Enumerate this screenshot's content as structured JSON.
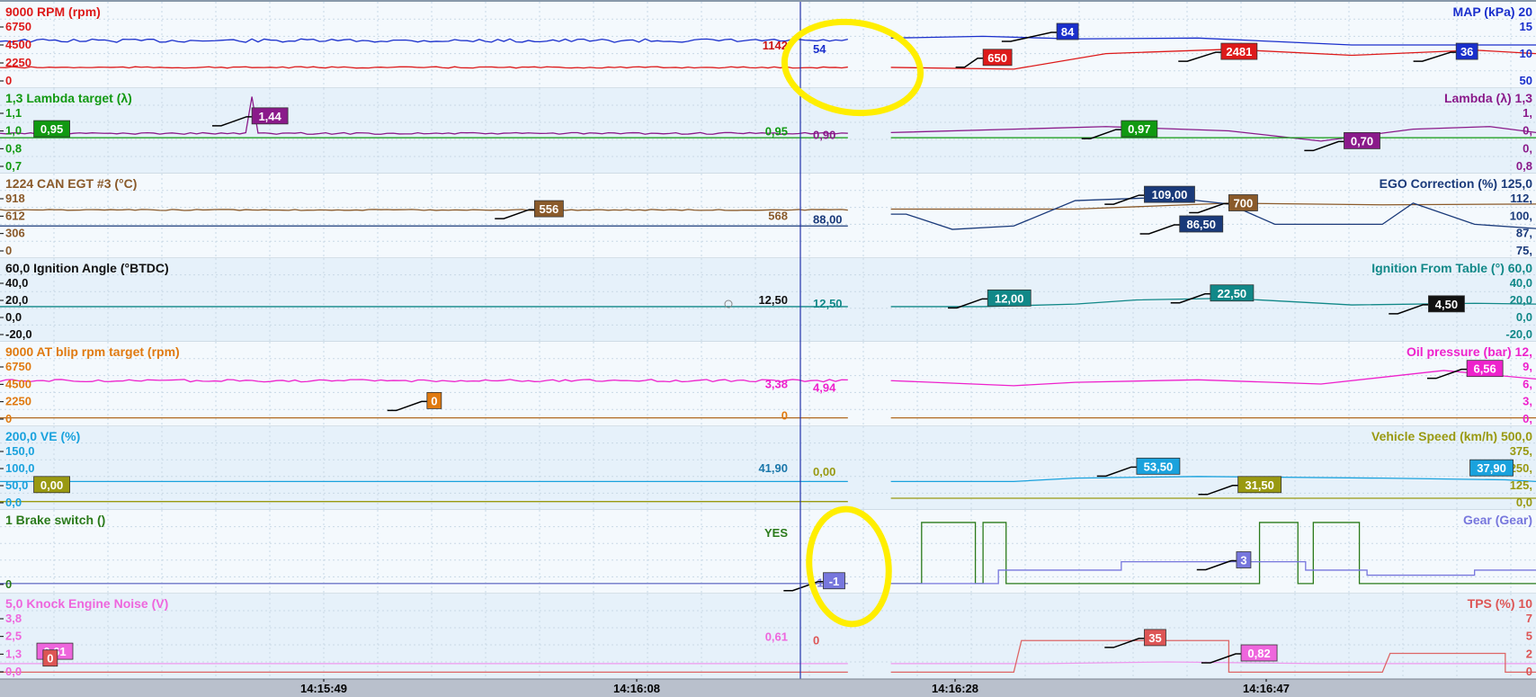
{
  "colors": {
    "bg_a": "#f4f9fd",
    "bg_b": "#e6f1fa",
    "grid": "#c9d9e6",
    "separator": "#b8c6d2",
    "cursor": "#2233aa",
    "timebar_bg": "#b9c0cc",
    "timebar_text": "#000000",
    "highlight": "#ffee00"
  },
  "time_axis": {
    "ticks": [
      "14:15:49",
      "14:16:08",
      "14:16:28",
      "14:16:47"
    ]
  },
  "cursor": {
    "position_fraction": 0.521
  },
  "lanes": [
    {
      "id": "rpm-map",
      "left": {
        "title": "9000 RPM (rpm)",
        "color": "#dd1a1a",
        "ticks": [
          "6750",
          "4500",
          "2250",
          "0"
        ]
      },
      "right": {
        "title": "MAP (kPa) 20",
        "color": "#1a2fcc",
        "ticks": [
          "15",
          "10",
          "50"
        ]
      },
      "cursor_left": {
        "text": "1142",
        "color": "#cc1111"
      },
      "cursor_right": {
        "text": "54",
        "color": "#1a2fcc"
      },
      "tags": [
        {
          "text": "84",
          "bg": "#1a2fcc",
          "fg": "#ffffff",
          "fx": 0.688,
          "fy": 0.25,
          "lead": 0.03
        },
        {
          "text": "650",
          "bg": "#dd1a1a",
          "fg": "#ffffff",
          "fx": 0.64,
          "fy": 0.55,
          "lead": 0.012
        },
        {
          "text": "2481",
          "bg": "#dd1a1a",
          "fg": "#ffffff",
          "fx": 0.795,
          "fy": 0.48,
          "lead": 0.022
        },
        {
          "text": "36",
          "bg": "#1a2fcc",
          "fg": "#ffffff",
          "fx": 0.948,
          "fy": 0.48,
          "lead": 0.022
        }
      ]
    },
    {
      "id": "lambda",
      "left": {
        "title": "1,3 Lambda target (λ)",
        "color": "#119911",
        "ticks": [
          "1,1",
          "1,0",
          "0,8",
          "0,7"
        ]
      },
      "right": {
        "title": "Lambda (λ) 1,3",
        "color": "#8a1a8a",
        "ticks": [
          "1,",
          "0,",
          "0,",
          "0,8"
        ]
      },
      "cursor_left": {
        "text": "0,95",
        "color": "#119911"
      },
      "cursor_right": {
        "text": "0,90",
        "color": "#8a1a8a"
      },
      "tags": [
        {
          "text": "0,95",
          "bg": "#119911",
          "fg": "#ffffff",
          "fx": 0.022,
          "fy": 0.38,
          "lead": 0
        },
        {
          "text": "1,44",
          "bg": "#8a1a8a",
          "fg": "#ffffff",
          "fx": 0.164,
          "fy": 0.23,
          "lead": 0.02
        },
        {
          "text": "0,97",
          "bg": "#119911",
          "fg": "#ffffff",
          "fx": 0.73,
          "fy": 0.38,
          "lead": 0.02
        },
        {
          "text": "0,70",
          "bg": "#8a1a8a",
          "fg": "#ffffff",
          "fx": 0.875,
          "fy": 0.52,
          "lead": 0.02
        }
      ]
    },
    {
      "id": "egt-ego",
      "left": {
        "title": "1224 CAN EGT #3 (°C)",
        "color": "#8a5a2a",
        "ticks": [
          "918",
          "612",
          "306",
          "0"
        ]
      },
      "right": {
        "title": "EGO Correction (%) 125,0",
        "color": "#1a3a7a",
        "ticks": [
          "112,",
          "100,",
          "87,",
          "75,"
        ]
      },
      "cursor_left": {
        "text": "568",
        "color": "#8a5a2a"
      },
      "cursor_right": {
        "text": "88,00",
        "color": "#1a3a7a"
      },
      "tags": [
        {
          "text": "556",
          "bg": "#8a5a2a",
          "fg": "#ffffff",
          "fx": 0.348,
          "fy": 0.32,
          "lead": 0.02
        },
        {
          "text": "109,00",
          "bg": "#1a3a7a",
          "fg": "#ffffff",
          "fx": 0.745,
          "fy": 0.15,
          "lead": 0.02
        },
        {
          "text": "700",
          "bg": "#8a5a2a",
          "fg": "#ffffff",
          "fx": 0.8,
          "fy": 0.25,
          "lead": 0.02
        },
        {
          "text": "86,50",
          "bg": "#1a3a7a",
          "fg": "#ffffff",
          "fx": 0.768,
          "fy": 0.5,
          "lead": 0.02
        }
      ]
    },
    {
      "id": "ignition",
      "left": {
        "title": "60,0 Ignition Angle (°BTDC)",
        "color": "#111111",
        "ticks": [
          "40,0",
          "20,0",
          "0,0",
          "-20,0"
        ]
      },
      "right": {
        "title": "Ignition From Table (°) 60,0",
        "color": "#118888",
        "ticks": [
          "40,0",
          "20,0",
          "0,0",
          "-20,0"
        ]
      },
      "cursor_left": {
        "text": "12,50",
        "color": "#111111"
      },
      "cursor_right": {
        "text": "12,50",
        "color": "#118888"
      },
      "tags": [
        {
          "text": "12,00",
          "bg": "#118888",
          "fg": "#ffffff",
          "fx": 0.643,
          "fy": 0.38,
          "lead": 0.02
        },
        {
          "text": "22,50",
          "bg": "#118888",
          "fg": "#ffffff",
          "fx": 0.788,
          "fy": 0.32,
          "lead": 0.02
        },
        {
          "text": "4,50",
          "bg": "#111111",
          "fg": "#ffffff",
          "fx": 0.93,
          "fy": 0.45,
          "lead": 0.02
        }
      ]
    },
    {
      "id": "blip-oil",
      "left": {
        "title": "9000 AT blip rpm target (rpm)",
        "color": "#e07a10",
        "ticks": [
          "6750",
          "4500",
          "2250",
          "0"
        ]
      },
      "right": {
        "title": "Oil pressure (bar) 12,",
        "color": "#ee22cc",
        "ticks": [
          "9,",
          "6,",
          "3,",
          "0,"
        ]
      },
      "cursor_left": {
        "text": "3,38",
        "color": "#ee22cc"
      },
      "cursor_left2": {
        "text": "0",
        "color": "#e07a10"
      },
      "cursor_right": {
        "text": "4,94",
        "color": "#ee22cc"
      },
      "tags": [
        {
          "text": "0",
          "bg": "#e07a10",
          "fg": "#ffffff",
          "fx": 0.278,
          "fy": 0.6,
          "lead": 0.02
        },
        {
          "text": "6,56",
          "bg": "#ee22cc",
          "fg": "#ffffff",
          "fx": 0.955,
          "fy": 0.22,
          "lead": 0.02
        }
      ]
    },
    {
      "id": "ve-speed",
      "left": {
        "title": "200,0 VE (%)",
        "color": "#1aa2dd",
        "ticks": [
          "150,0",
          "100,0",
          "50,0",
          "0,0"
        ]
      },
      "right": {
        "title": "Vehicle Speed (km/h) 500,0",
        "color": "#999911",
        "ticks": [
          "375,",
          "250,",
          "125,",
          "0,0"
        ]
      },
      "cursor_left": {
        "text": "41,90",
        "color": "#1a77aa"
      },
      "cursor_right": {
        "text": "0,00",
        "color": "#999911"
      },
      "tags": [
        {
          "text": "0,00",
          "bg": "#999911",
          "fg": "#ffffff",
          "fx": 0.022,
          "fy": 0.6,
          "lead": 0
        },
        {
          "text": "53,50",
          "bg": "#1aa2dd",
          "fg": "#ffffff",
          "fx": 0.74,
          "fy": 0.38,
          "lead": 0.02
        },
        {
          "text": "31,50",
          "bg": "#999911",
          "fg": "#ffffff",
          "fx": 0.806,
          "fy": 0.6,
          "lead": 0.02
        },
        {
          "text": "37,90",
          "bg": "#1aa2dd",
          "fg": "#ffffff",
          "fx": 0.957,
          "fy": 0.4,
          "lead": 0
        }
      ]
    },
    {
      "id": "brake-gear",
      "left": {
        "title": "1 Brake switch ()",
        "color": "#2a7a1a",
        "ticks": [
          "0"
        ]
      },
      "right": {
        "title": "Gear (Gear)",
        "color": "#7777dd",
        "ticks": []
      },
      "cursor_left": {
        "text": "YES",
        "color": "#2a7a1a"
      },
      "cursor_right": {
        "text": "-1",
        "color": "#7777dd"
      },
      "tags": [
        {
          "text": "-1",
          "bg": "#7777dd",
          "fg": "#ffffff",
          "fx": 0.536,
          "fy": 0.75,
          "lead": 0.02
        },
        {
          "text": "3",
          "bg": "#7777dd",
          "fg": "#ffffff",
          "fx": 0.805,
          "fy": 0.5,
          "lead": 0.02
        }
      ]
    },
    {
      "id": "knock-tps",
      "left": {
        "title": "5,0 Knock Engine Noise (V)",
        "color": "#ee66dd",
        "ticks": [
          "3,8",
          "2,5",
          "1,3",
          "0,0"
        ]
      },
      "right": {
        "title": "TPS (%) 10",
        "color": "#dd5555",
        "ticks": [
          "7",
          "5",
          "2",
          "0"
        ]
      },
      "cursor_left": {
        "text": "0,61",
        "color": "#ee66dd"
      },
      "cursor_right": {
        "text": "0",
        "color": "#dd5555"
      },
      "tags": [
        {
          "text": "0,61",
          "bg": "#ee66dd",
          "fg": "#ffffff",
          "fx": 0.024,
          "fy": 0.58,
          "lead": 0
        },
        {
          "text": "0",
          "bg": "#dd5555",
          "fg": "#ffffff",
          "fx": 0.028,
          "fy": 0.66,
          "lead": 0
        },
        {
          "text": "35",
          "bg": "#dd5555",
          "fg": "#ffffff",
          "fx": 0.745,
          "fy": 0.42,
          "lead": 0.02
        },
        {
          "text": "0,82",
          "bg": "#ee66dd",
          "fg": "#ffffff",
          "fx": 0.808,
          "fy": 0.6,
          "lead": 0.02
        }
      ]
    }
  ],
  "traces": [
    {
      "lane": 0,
      "color": "#1a2fcc",
      "level": 0.45,
      "noise": 0.02,
      "after": [
        [
          0.58,
          0.42
        ],
        [
          0.64,
          0.4
        ],
        [
          0.7,
          0.43
        ],
        [
          0.78,
          0.42
        ],
        [
          0.88,
          0.5
        ],
        [
          1.0,
          0.5
        ]
      ]
    },
    {
      "lane": 0,
      "color": "#dd1a1a",
      "level": 0.76,
      "noise": 0.008,
      "after": [
        [
          0.58,
          0.76
        ],
        [
          0.66,
          0.78
        ],
        [
          0.72,
          0.6
        ],
        [
          0.8,
          0.55
        ],
        [
          0.88,
          0.62
        ],
        [
          0.96,
          0.56
        ],
        [
          1.0,
          0.6
        ]
      ]
    },
    {
      "lane": 1,
      "color": "#8a1a8a",
      "level": 0.53,
      "noise": 0.01,
      "spike": 0.166,
      "after": [
        [
          0.58,
          0.52
        ],
        [
          0.66,
          0.48
        ],
        [
          0.72,
          0.45
        ],
        [
          0.8,
          0.5
        ],
        [
          0.86,
          0.62
        ],
        [
          0.92,
          0.48
        ],
        [
          0.97,
          0.45
        ],
        [
          1.0,
          0.52
        ]
      ]
    },
    {
      "lane": 1,
      "color": "#119911",
      "level": 0.58,
      "noise": 0.0,
      "after": [
        [
          1.0,
          0.58
        ]
      ]
    },
    {
      "lane": 2,
      "color": "#8a5a2a",
      "level": 0.43,
      "noise": 0.006,
      "after": [
        [
          0.6,
          0.42
        ],
        [
          0.7,
          0.42
        ],
        [
          0.8,
          0.35
        ],
        [
          0.9,
          0.37
        ],
        [
          1.0,
          0.36
        ]
      ]
    },
    {
      "lane": 2,
      "color": "#1a3a7a",
      "level": 0.62,
      "noise": 0.0,
      "after": [
        [
          0.59,
          0.48
        ],
        [
          0.62,
          0.66
        ],
        [
          0.66,
          0.62
        ],
        [
          0.7,
          0.32
        ],
        [
          0.76,
          0.28
        ],
        [
          0.8,
          0.36
        ],
        [
          0.83,
          0.6
        ],
        [
          0.9,
          0.6
        ],
        [
          0.92,
          0.35
        ],
        [
          0.96,
          0.6
        ],
        [
          1.0,
          0.65
        ]
      ]
    },
    {
      "lane": 3,
      "color": "#118888",
      "level": 0.58,
      "noise": 0.0,
      "after": [
        [
          0.64,
          0.58
        ],
        [
          0.7,
          0.55
        ],
        [
          0.74,
          0.5
        ],
        [
          0.8,
          0.48
        ],
        [
          0.88,
          0.56
        ],
        [
          0.96,
          0.54
        ],
        [
          1.0,
          0.55
        ]
      ]
    },
    {
      "lane": 4,
      "color": "#ee22cc",
      "level": 0.46,
      "noise": 0.015,
      "after": [
        [
          0.58,
          0.46
        ],
        [
          0.66,
          0.52
        ],
        [
          0.7,
          0.48
        ],
        [
          0.78,
          0.45
        ],
        [
          0.86,
          0.5
        ],
        [
          0.94,
          0.34
        ],
        [
          1.0,
          0.44
        ]
      ]
    },
    {
      "lane": 4,
      "color": "#b06a20",
      "level": 0.9,
      "noise": 0.0,
      "after": [
        [
          1.0,
          0.9
        ]
      ]
    },
    {
      "lane": 5,
      "color": "#1aa2dd",
      "level": 0.66,
      "noise": 0.0,
      "after": [
        [
          0.66,
          0.66
        ],
        [
          0.7,
          0.62
        ],
        [
          0.78,
          0.6
        ],
        [
          0.9,
          0.62
        ],
        [
          0.98,
          0.64
        ],
        [
          1.0,
          0.66
        ]
      ]
    },
    {
      "lane": 5,
      "color": "#999911",
      "level": 0.9,
      "noise": 0.0,
      "after": [
        [
          1.0,
          0.86
        ]
      ]
    },
    {
      "lane": 6,
      "color": "#2a7a1a",
      "level": 0.88,
      "noise": 0.0,
      "after": [
        [
          0.6,
          0.88
        ],
        [
          0.6,
          0.15
        ],
        [
          0.635,
          0.15
        ],
        [
          0.635,
          0.88
        ],
        [
          0.64,
          0.88
        ],
        [
          0.64,
          0.15
        ],
        [
          0.655,
          0.15
        ],
        [
          0.655,
          0.88
        ],
        [
          0.82,
          0.88
        ],
        [
          0.82,
          0.15
        ],
        [
          0.845,
          0.15
        ],
        [
          0.845,
          0.88
        ],
        [
          0.855,
          0.88
        ],
        [
          0.855,
          0.15
        ],
        [
          0.885,
          0.15
        ],
        [
          0.885,
          0.88
        ],
        [
          1.0,
          0.88
        ]
      ]
    },
    {
      "lane": 6,
      "color": "#7777dd",
      "level": 0.88,
      "noise": 0.0,
      "after": [
        [
          0.65,
          0.88
        ],
        [
          0.65,
          0.72
        ],
        [
          0.73,
          0.72
        ],
        [
          0.73,
          0.62
        ],
        [
          0.85,
          0.62
        ],
        [
          0.85,
          0.72
        ],
        [
          0.89,
          0.72
        ],
        [
          0.89,
          0.78
        ],
        [
          0.96,
          0.78
        ],
        [
          0.96,
          0.72
        ],
        [
          1.0,
          0.72
        ]
      ]
    },
    {
      "lane": 7,
      "color": "#ee99ee",
      "level": 0.82,
      "noise": 0.0,
      "after": [
        [
          0.68,
          0.82
        ],
        [
          0.76,
          0.8
        ],
        [
          0.86,
          0.82
        ],
        [
          0.96,
          0.82
        ],
        [
          1.0,
          0.82
        ]
      ]
    },
    {
      "lane": 7,
      "color": "#dd6666",
      "level": 0.92,
      "noise": 0.0,
      "after": [
        [
          0.66,
          0.92
        ],
        [
          0.665,
          0.55
        ],
        [
          0.8,
          0.55
        ],
        [
          0.8,
          0.92
        ],
        [
          0.9,
          0.92
        ],
        [
          0.905,
          0.7
        ],
        [
          0.98,
          0.7
        ],
        [
          0.98,
          0.92
        ],
        [
          1.0,
          0.92
        ]
      ]
    }
  ]
}
